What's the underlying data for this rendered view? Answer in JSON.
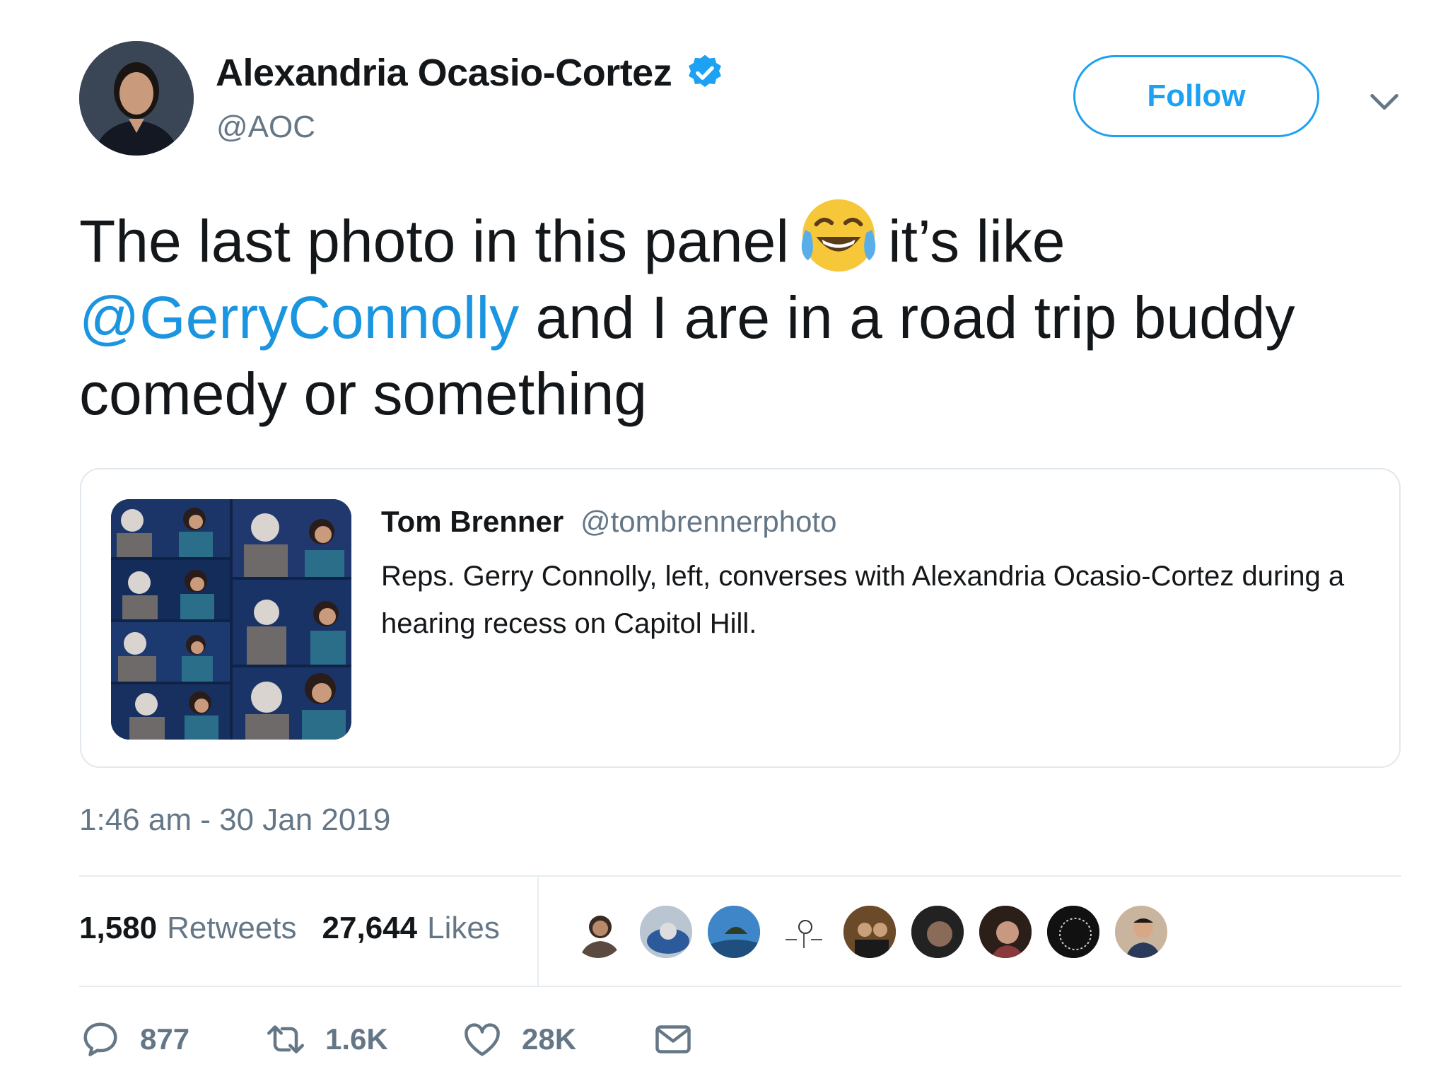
{
  "author": {
    "name": "Alexandria Ocasio-Cortez",
    "handle": "@AOC",
    "verified": true
  },
  "follow_label": "Follow",
  "tweet": {
    "text_part1": "The last photo in this panel",
    "emoji": "face-with-tears-of-joy",
    "text_part2": "it’s like",
    "mention": "@GerryConnolly",
    "text_part3": "and I are in a road trip buddy comedy or something"
  },
  "quoted": {
    "name": "Tom Brenner",
    "handle": "@tombrennerphoto",
    "text": "Reps. Gerry Connolly, left, converses with Alexandria Ocasio-Cortez during a hearing recess on Capitol Hill."
  },
  "timestamp": "1:46 am - 30 Jan 2019",
  "stats": {
    "retweets_count": "1,580",
    "retweets_label": "Retweets",
    "likes_count": "27,644",
    "likes_label": "Likes"
  },
  "actions": {
    "reply_count": "877",
    "retweet_count": "1.6K",
    "like_count": "28K"
  },
  "colors": {
    "accent": "#1da1f2",
    "mention": "#1b95e0",
    "muted": "#657786",
    "border": "#e1e8ed"
  }
}
